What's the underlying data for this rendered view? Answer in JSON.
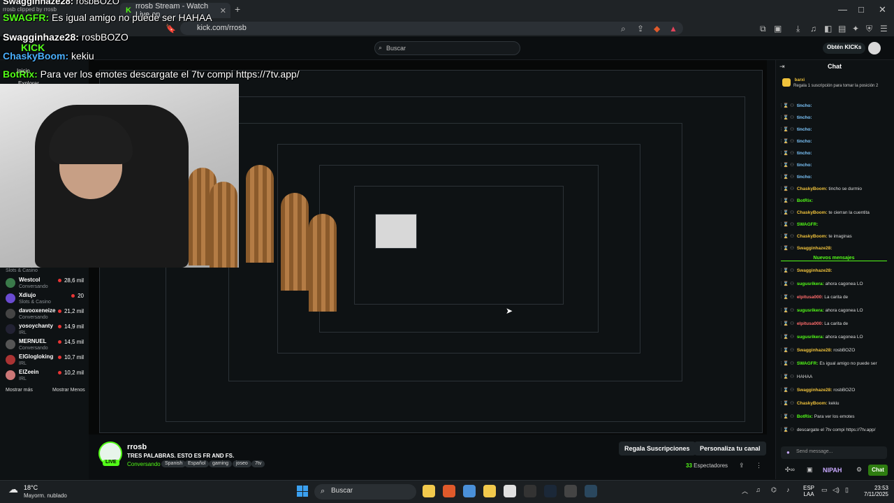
{
  "browser": {
    "tab_title": "rrosb Stream - Watch Live on",
    "new_tab": "+",
    "url": "kick.com/rrosb",
    "window_controls": [
      "—",
      "□",
      "✕"
    ]
  },
  "header": {
    "search_placeholder": "Buscar",
    "cta": "Obtén KICKs"
  },
  "sidebar": {
    "items": [
      {
        "name": "Westcol",
        "category": "Conversando",
        "viewers": "28,6 mil",
        "color": "#3a7a4a"
      },
      {
        "name": "Xdiujo",
        "category": "Slots & Casino",
        "viewers": "20",
        "color": "#6a4bd1"
      },
      {
        "name": "davooxeneize",
        "category": "Conversando",
        "viewers": "21,2 mil",
        "color": "#444"
      },
      {
        "name": "yosoychanty",
        "category": "IRL",
        "viewers": "14,9 mil",
        "color": "#223"
      },
      {
        "name": "MERNUEL",
        "category": "Conversando",
        "viewers": "14,5 mil",
        "color": "#555"
      },
      {
        "name": "ElGlogloking",
        "category": "IRL",
        "viewers": "10,7 mil",
        "color": "#a33"
      },
      {
        "name": "ElZeein",
        "category": "IRL",
        "viewers": "10,2 mil",
        "color": "#c77"
      }
    ],
    "top_category": "Slots & Casino",
    "show_more": "Mostrar más",
    "show_less": "Mostrar Menos"
  },
  "overlay": {
    "line0": "rrosb clipped by rrosb",
    "line1_user": "SWAGFR:",
    "line1_text": "Es igual amigo no puede ser HAHAA",
    "line2_user": "Swagginhaze28:",
    "line2_text": "rosbBOZO",
    "line3_user": "ChaskyBoom:",
    "line3_text": "kekiu",
    "line4_user": "BotRix:",
    "line4_text": "Para ver los emotes descargate el 7tv compi",
    "line4_link": "https://7tv.app/",
    "top_user": "Swagginhaze28:",
    "top_text": "rosbBOZO",
    "kick_logo": "KICK",
    "nav1": "Inicio",
    "nav2": "Explorar"
  },
  "stream_info": {
    "name": "rrosb",
    "title": "TRES PALABRAS. ESTO ES FR AND FS.",
    "category": "Conversando",
    "tags": [
      "Spanish",
      "Español",
      "gaming",
      "joseo",
      "7tv"
    ],
    "live": "LIVE",
    "gift_button": "Regala Suscripciones",
    "customize_button": "Personaliza tu canal",
    "viewers_count": "33",
    "viewers_label": "Espectadores"
  },
  "chat": {
    "title": "Chat",
    "pinned_user": "barxi",
    "pinned_text": "Regala 1 suscripción para tomar la posición 2",
    "messages": [
      {
        "user": "tincho:",
        "text": "",
        "cls": "u4"
      },
      {
        "user": "tincho:",
        "text": "",
        "cls": "u4"
      },
      {
        "user": "tincho:",
        "text": "",
        "cls": "u4"
      },
      {
        "user": "tincho:",
        "text": "",
        "cls": "u4"
      },
      {
        "user": "tincho:",
        "text": "",
        "cls": "u4"
      },
      {
        "user": "tincho:",
        "text": "",
        "cls": "u4"
      },
      {
        "user": "tincho:",
        "text": "",
        "cls": "u4"
      },
      {
        "user": "ChaskyBoom:",
        "text": "tincho se durmio",
        "cls": "u2"
      },
      {
        "user": "BotRix:",
        "text": "",
        "cls": "u1"
      },
      {
        "user": "ChaskyBoom:",
        "text": "te cierran la cuentita",
        "cls": "u2"
      },
      {
        "user": "SWAGFR:",
        "text": "",
        "cls": "u1"
      },
      {
        "user": "ChaskyBoom:",
        "text": "te imaginas",
        "cls": "u2"
      },
      {
        "user": "Swagginhaze28:",
        "text": "",
        "cls": "u2"
      }
    ],
    "new_messages": "Nuevos mensajes",
    "messages2": [
      {
        "user": "Swagginhaze28:",
        "text": "",
        "cls": "u2"
      },
      {
        "user": "sugusrikera:",
        "text": "ahora cagonea LO",
        "cls": "u1"
      },
      {
        "user": "elpitusa000:",
        "text": "La carita de",
        "cls": "u3"
      },
      {
        "user": "sugusrikera:",
        "text": "ahora cagonea LO",
        "cls": "u1"
      },
      {
        "user": "elpitusa000:",
        "text": "La carita de",
        "cls": "u3"
      },
      {
        "user": "sugusrikera:",
        "text": "ahora cagonea LO",
        "cls": "u1"
      },
      {
        "user": "Swagginhaze28:",
        "text": "rosbBOZO",
        "cls": "u2"
      },
      {
        "user": "SWAGFR:",
        "text": "Es igual amigo no puede ser",
        "cls": "u1"
      },
      {
        "user": "",
        "text": "HAHAA",
        "cls": "u1"
      },
      {
        "user": "Swagginhaze28:",
        "text": "rosbBOZO",
        "cls": "u2"
      },
      {
        "user": "ChaskyBoom:",
        "text": "kekiu",
        "cls": "u2"
      },
      {
        "user": "BotRix:",
        "text": "Para ver los emotes",
        "cls": "u1"
      },
      {
        "user": "",
        "text": "descargate el 7tv compi  https://7tv.app/",
        "cls": "u1"
      }
    ],
    "send_placeholder": "Send message...",
    "brand": "NIPAH",
    "chat_button": "Chat"
  },
  "taskbar": {
    "temp": "18°C",
    "weather": "Mayorm. nublado",
    "search": "Buscar",
    "lang1": "ESP",
    "lang2": "LAA",
    "time": "23:53",
    "date": "7/11/2025",
    "apps": [
      {
        "name": "file-explorer-icon",
        "color": "#f2c94c"
      },
      {
        "name": "brave-icon",
        "color": "#e05a2b"
      },
      {
        "name": "chrome-icon",
        "color": "#4a90d9"
      },
      {
        "name": "folder-icon",
        "color": "#f2c94c"
      },
      {
        "name": "store-icon",
        "color": "#e0e0e0"
      },
      {
        "name": "epic-icon",
        "color": "#333"
      },
      {
        "name": "steam-icon",
        "color": "#1b2838"
      },
      {
        "name": "obs-icon",
        "color": "#444"
      },
      {
        "name": "steam2-icon",
        "color": "#2a475e"
      }
    ]
  }
}
